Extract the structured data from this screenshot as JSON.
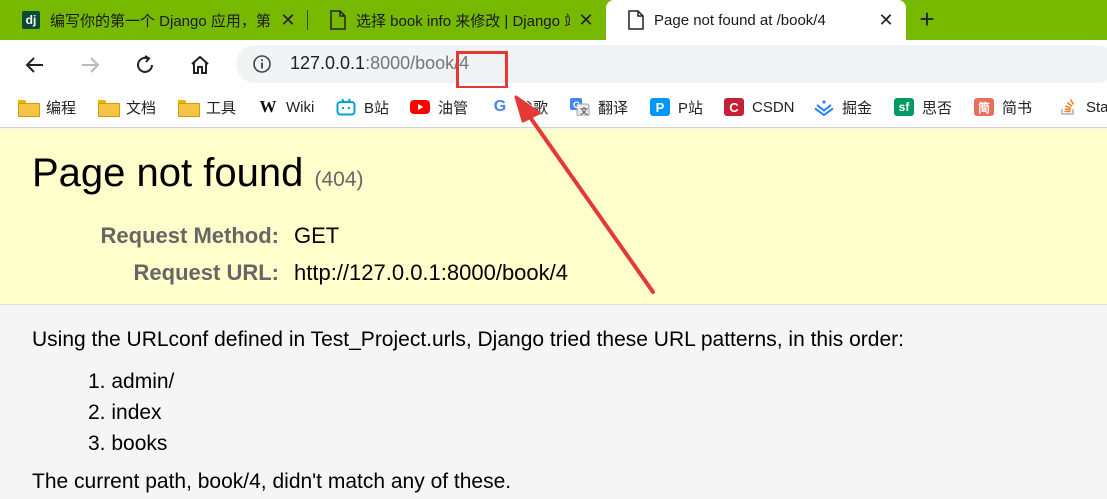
{
  "tabs": [
    {
      "title": "编写你的第一个 Django 应用，第"
    },
    {
      "title": "选择 book info 来修改 | Django 站"
    },
    {
      "title": "Page not found at /book/4"
    }
  ],
  "toolbar": {
    "url_host": "127.0.0.1",
    "url_rest": ":8000/book/4"
  },
  "bookmarks": [
    {
      "label": "编程",
      "icon": "folder-icon"
    },
    {
      "label": "文档",
      "icon": "folder-icon"
    },
    {
      "label": "工具",
      "icon": "folder-icon"
    },
    {
      "label": "Wiki",
      "icon": "wikipedia-icon",
      "glyph": "W"
    },
    {
      "label": "B站",
      "icon": "bilibili-icon"
    },
    {
      "label": "油管",
      "icon": "youtube-icon"
    },
    {
      "label": "谷歌",
      "icon": "google-icon",
      "glyph": "G"
    },
    {
      "label": "翻译",
      "icon": "translate-icon"
    },
    {
      "label": "P站",
      "icon": "pixiv-icon",
      "glyph": "P"
    },
    {
      "label": "CSDN",
      "icon": "csdn-icon",
      "glyph": "C"
    },
    {
      "label": "掘金",
      "icon": "juejin-icon"
    },
    {
      "label": "思否",
      "icon": "segmentfault-icon",
      "glyph": "sf"
    },
    {
      "label": "简书",
      "icon": "jianshu-icon",
      "glyph": "简"
    },
    {
      "label": "Stac",
      "icon": "stackoverflow-icon"
    }
  ],
  "page": {
    "title": "Page not found",
    "code": "(404)",
    "request_method_label": "Request Method:",
    "request_method": "GET",
    "request_url_label": "Request URL:",
    "request_url": "http://127.0.0.1:8000/book/4",
    "intro": "Using the URLconf defined in Test_Project.urls, Django tried these URL patterns, in this order:",
    "patterns": [
      "1. admin/",
      "2. index",
      "3. books"
    ],
    "current": "The current path, book/4, didn't match any of these."
  },
  "colors": {
    "tabstrip": "#76b900",
    "summary_bg": "#ffffcc",
    "annotation": "#e53935"
  }
}
